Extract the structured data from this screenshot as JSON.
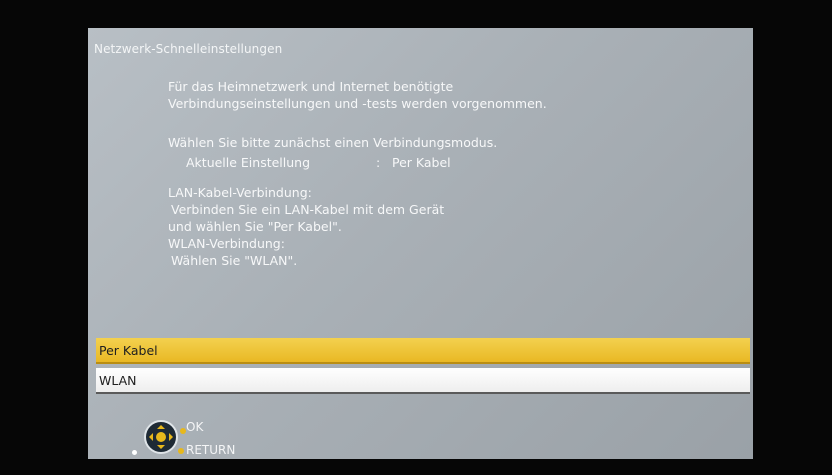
{
  "screen": {
    "title": "Netzwerk-Schnelleinstellungen",
    "intro_line1": "Für das Heimnetzwerk und Internet benötigte",
    "intro_line2": "Verbindungseinstellungen und -tests werden vorgenommen.",
    "select_prompt": "Wählen Sie bitte zunächst einen Verbindungsmodus.",
    "current_setting": {
      "label": "Aktuelle Einstellung",
      "separator": ":",
      "value": "Per Kabel"
    },
    "help": {
      "line1": "LAN-Kabel-Verbindung:",
      "line2": "Verbinden Sie ein LAN-Kabel mit dem Gerät",
      "line3": "und wählen Sie \"Per Kabel\".",
      "line4": "WLAN-Verbindung:",
      "line5": "Wählen Sie \"WLAN\"."
    }
  },
  "options": [
    {
      "label": "Per Kabel",
      "selected": true
    },
    {
      "label": "WLAN",
      "selected": false
    }
  ],
  "footer": {
    "ok_label": "OK",
    "return_label": "RETURN"
  },
  "colors": {
    "background": "#a9b0b6",
    "selected_highlight": "#e9b824",
    "text": "#f7f8f9",
    "bezel": "#060606"
  },
  "icons": {
    "dpad": "dpad-icon",
    "ok": "ok-button-icon",
    "return": "return-button-icon"
  }
}
